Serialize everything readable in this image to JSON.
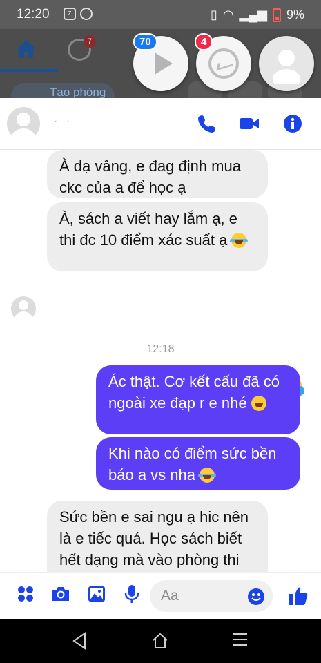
{
  "status_bar": {
    "time": "12:20",
    "battery": "9%"
  },
  "facebook_bar": {
    "friends_badge": "7",
    "create_room_label": "Tạo phòng"
  },
  "chat_heads": {
    "video_badge": "70",
    "messenger_badge": "4"
  },
  "chat": {
    "contact_name": "·   ·",
    "timestamp": "12:18",
    "messages": [
      {
        "side": "in",
        "text": "À dạ vâng, e đag định mua ckc của a để học ạ"
      },
      {
        "side": "in",
        "text": "À, sách a viết hay lắm ạ, e thi đc 10 điểm xác suất ạ",
        "emoji": "joy-emoji"
      },
      {
        "side": "out",
        "text": "Ác thật. Cơ kết cấu đã có ngoài xe đạp r e nhé",
        "emoji": "grin-emoji"
      },
      {
        "side": "out",
        "text": "Khi nào có điểm sức bền báo a vs nha",
        "emoji": "joy-emoji"
      },
      {
        "side": "in",
        "text": "Sức bền e sai ngu ạ hic nên là e tiếc quá. Học sách biết hết dạng mà vào phòng thi hơi loạn nên đếm ra say"
      }
    ]
  },
  "composer": {
    "placeholder": "Aa"
  },
  "colors": {
    "accent": "#5b3ef5",
    "icon_blue": "#1a44e8",
    "incoming_bubble": "#ededed"
  }
}
